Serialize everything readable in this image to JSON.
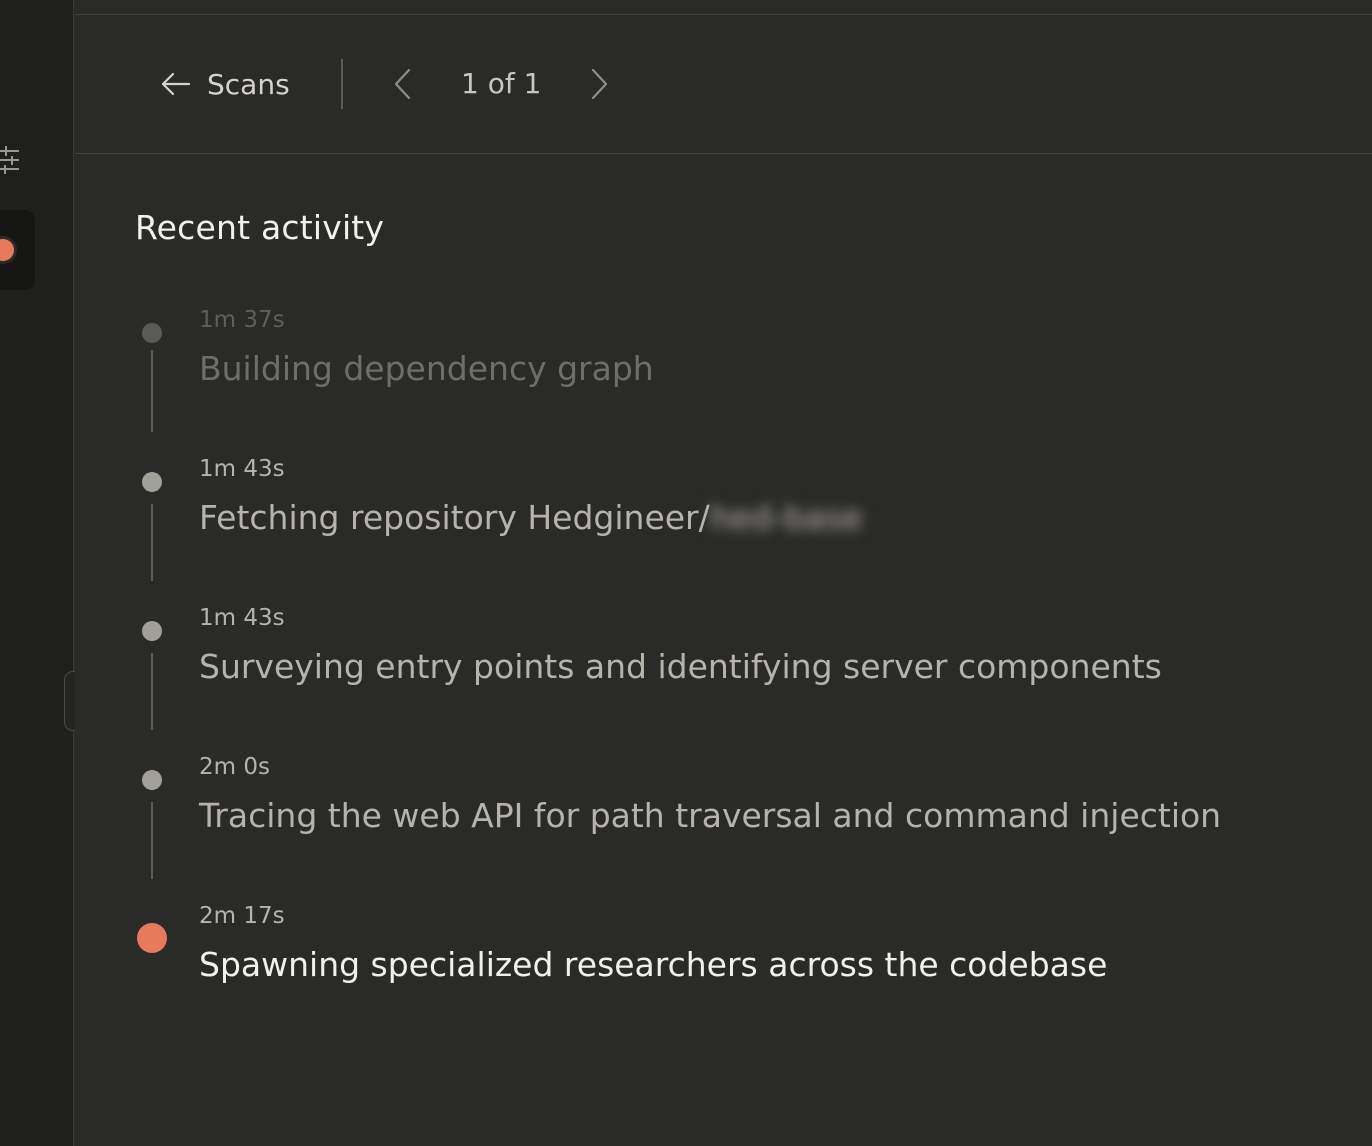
{
  "toolbar": {
    "back_label": "Scans",
    "pager_text": "1 of 1"
  },
  "activity": {
    "title": "Recent activity",
    "events": [
      {
        "time": "1m 37s",
        "title": "Building dependency graph",
        "state": "faded"
      },
      {
        "time": "1m 43s",
        "title": "Fetching repository Hedgineer/",
        "redacted_suffix": "hed-base",
        "state": "past"
      },
      {
        "time": "1m 43s",
        "title": "Surveying entry points and identifying server components",
        "state": "past"
      },
      {
        "time": "2m 0s",
        "title": "Tracing the web API for path traversal and command injection",
        "state": "past"
      },
      {
        "time": "2m 17s",
        "title": "Spawning specialized researchers across the codebase",
        "state": "current"
      }
    ]
  },
  "colors": {
    "accent": "#e57b5a",
    "background": "#2a2a29",
    "sidebar": "#1f1f1e",
    "text_primary": "#f2f0ec",
    "text_secondary": "#b6b3ad",
    "text_faded": "#6e6d6a"
  },
  "icons": {
    "back": "arrow-left-icon",
    "prev": "chevron-left-icon",
    "next": "chevron-right-icon",
    "filter": "sliders-icon"
  }
}
